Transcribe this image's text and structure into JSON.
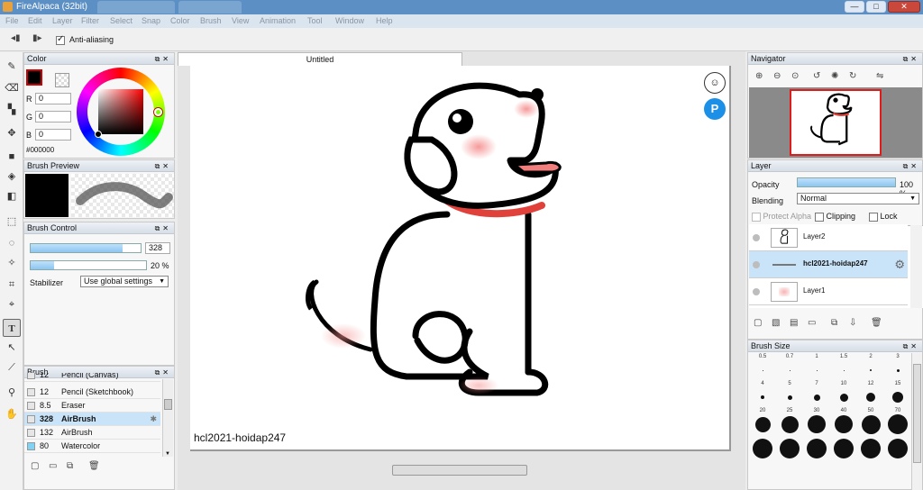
{
  "window": {
    "title": "FireAlpaca (32bit)",
    "bg_tab_1": "",
    "bg_tab_2": "",
    "buttons": {
      "minimize": "—",
      "maximize": "□",
      "close": "✕"
    }
  },
  "menu": [
    "File",
    "Edit",
    "Layer",
    "Filter",
    "Select",
    "Snap",
    "Color",
    "Brush",
    "View",
    "Animation",
    "Tool",
    "Window",
    "Help"
  ],
  "toolbar": {
    "anti_aliasing_label": "Anti-aliasing",
    "anti_aliasing_checked": true
  },
  "color_panel": {
    "title": "Color",
    "r_label": "R",
    "r_value": "0",
    "g_label": "G",
    "g_value": "0",
    "b_label": "B",
    "b_value": "0",
    "hex": "#000000",
    "primary_color": "#000000"
  },
  "brush_preview": {
    "title": "Brush Preview"
  },
  "brush_control": {
    "title": "Brush Control",
    "size_value": "328",
    "size_fraction": 0.84,
    "opacity_value": "20",
    "opacity_unit": "%",
    "opacity_fraction": 0.2,
    "stabilizer_label": "Stabilizer",
    "stabilizer_value": "Use global settings"
  },
  "brush_panel": {
    "title": "Brush",
    "items": [
      {
        "size": "12",
        "name": "Pencil (Canvas)"
      },
      {
        "size": "12",
        "name": "Pencil (Sketchbook)"
      },
      {
        "size": "8.5",
        "name": "Eraser"
      },
      {
        "size": "328",
        "name": "AirBrush"
      },
      {
        "size": "132",
        "name": "AirBrush"
      },
      {
        "size": "80",
        "name": "Watercolor"
      }
    ]
  },
  "document": {
    "tab_title": "Untitled",
    "watermark": "hcl2021-hoidap247"
  },
  "navigator": {
    "title": "Navigator"
  },
  "layer_panel": {
    "title": "Layer",
    "opacity_label": "Opacity",
    "opacity_value": "100",
    "opacity_unit": "%",
    "opacity_fraction": 1.0,
    "blending_label": "Blending",
    "blending_value": "Normal",
    "protect_alpha": "Protect Alpha",
    "clipping": "Clipping",
    "lock": "Lock",
    "layers": [
      {
        "name": "Layer2",
        "selected": false
      },
      {
        "name": "hcl2021-hoidap247",
        "selected": true
      },
      {
        "name": "Layer1",
        "selected": false
      }
    ]
  },
  "brush_size_panel": {
    "title": "Brush Size",
    "sizes": [
      "0.5",
      "0.7",
      "1",
      "1.5",
      "2",
      "3",
      "4",
      "5",
      "7",
      "10",
      "12",
      "15",
      "20",
      "25",
      "30",
      "40",
      "50",
      "70"
    ]
  },
  "colors": {
    "selection": "#c9e3f8",
    "slider_fill": "#8cc6f0",
    "collar": "#e0413a",
    "cheek": "#f7a5a5",
    "tongue": "#f27d7d"
  }
}
